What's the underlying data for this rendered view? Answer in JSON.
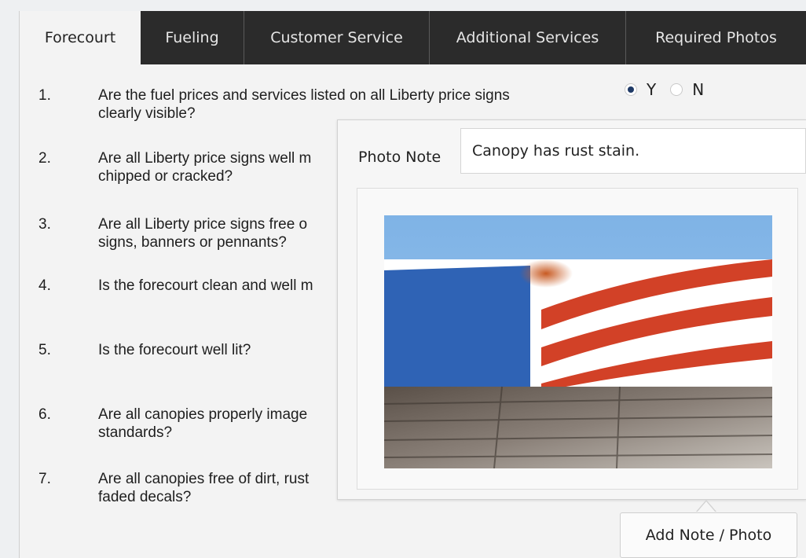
{
  "tabs": [
    {
      "label": "Forecourt",
      "active": true
    },
    {
      "label": "Fueling",
      "active": false
    },
    {
      "label": "Customer Service",
      "active": false
    },
    {
      "label": "Additional Services",
      "active": false
    },
    {
      "label": "Required Photos",
      "active": false
    }
  ],
  "questions": [
    {
      "num": "1.",
      "text": "Are the fuel prices and services listed on all Liberty price signs clearly visible?"
    },
    {
      "num": "2.",
      "text": "Are all Liberty price signs well m chipped or cracked?"
    },
    {
      "num": "3.",
      "text": "Are all Liberty price signs free o signs, banners or pennants?"
    },
    {
      "num": "4.",
      "text": "Is the forecourt clean and well m"
    },
    {
      "num": "5.",
      "text": "Is the forecourt well lit?"
    },
    {
      "num": "6.",
      "text": "Are all canopies properly image standards?"
    },
    {
      "num": "7.",
      "text": "Are all canopies free of dirt, rust faded decals?"
    }
  ],
  "answer": {
    "yes_label": "Y",
    "no_label": "N",
    "selected": "Y"
  },
  "popup": {
    "photo_note_label": "Photo Note",
    "photo_note_value": "Canopy has rust stain.",
    "photo_alt": "canopy-photo"
  },
  "add_button_label": "Add Note / Photo",
  "colors": {
    "tab_bg": "#2b2b2b",
    "radio_checked": "#1f3a66",
    "canopy_blue": "#2f63b5",
    "stripe_red": "#d24127"
  }
}
